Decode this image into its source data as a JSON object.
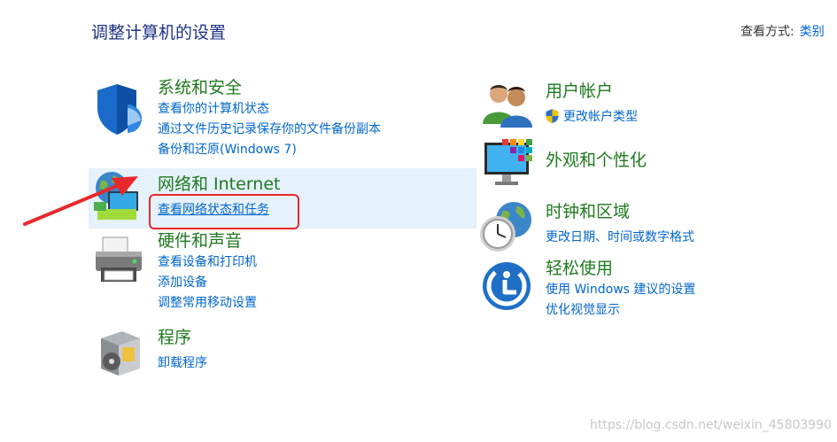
{
  "header": {
    "title": "调整计算机的设置",
    "view_by_label": "查看方式:",
    "view_by_value": "类别"
  },
  "categories": {
    "system": {
      "title": "系统和安全",
      "tasks": [
        "查看你的计算机状态",
        "通过文件历史记录保存你的文件备份副本",
        "备份和还原(Windows 7)"
      ]
    },
    "network": {
      "title": "网络和 Internet",
      "tasks": [
        "查看网络状态和任务"
      ]
    },
    "hardware": {
      "title": "硬件和声音",
      "tasks": [
        "查看设备和打印机",
        "添加设备",
        "调整常用移动设置"
      ]
    },
    "programs": {
      "title": "程序",
      "tasks": [
        "卸载程序"
      ]
    },
    "users": {
      "title": "用户帐户",
      "tasks": [
        "更改帐户类型"
      ]
    },
    "appearance": {
      "title": "外观和个性化",
      "tasks": []
    },
    "clock": {
      "title": "时钟和区域",
      "tasks": [
        "更改日期、时间或数字格式"
      ]
    },
    "ease": {
      "title": "轻松使用",
      "tasks": [
        "使用 Windows 建议的设置",
        "优化视觉显示"
      ]
    }
  },
  "watermark": "https://blog.csdn.net/weixin_45803990",
  "colors": {
    "category_title": "#1e7a1e",
    "link": "#0066cc",
    "page_title": "#1e3287",
    "hover_row": "#e5f1fb",
    "annotation": "#e8282b"
  },
  "icons": {
    "system": "shield-icon",
    "network": "globe-network-icon",
    "hardware": "printer-icon",
    "programs": "program-box-icon",
    "users": "users-icon",
    "appearance": "monitor-palette-icon",
    "clock": "clock-globe-icon",
    "ease": "accessibility-icon",
    "uac": "uac-shield-icon"
  }
}
